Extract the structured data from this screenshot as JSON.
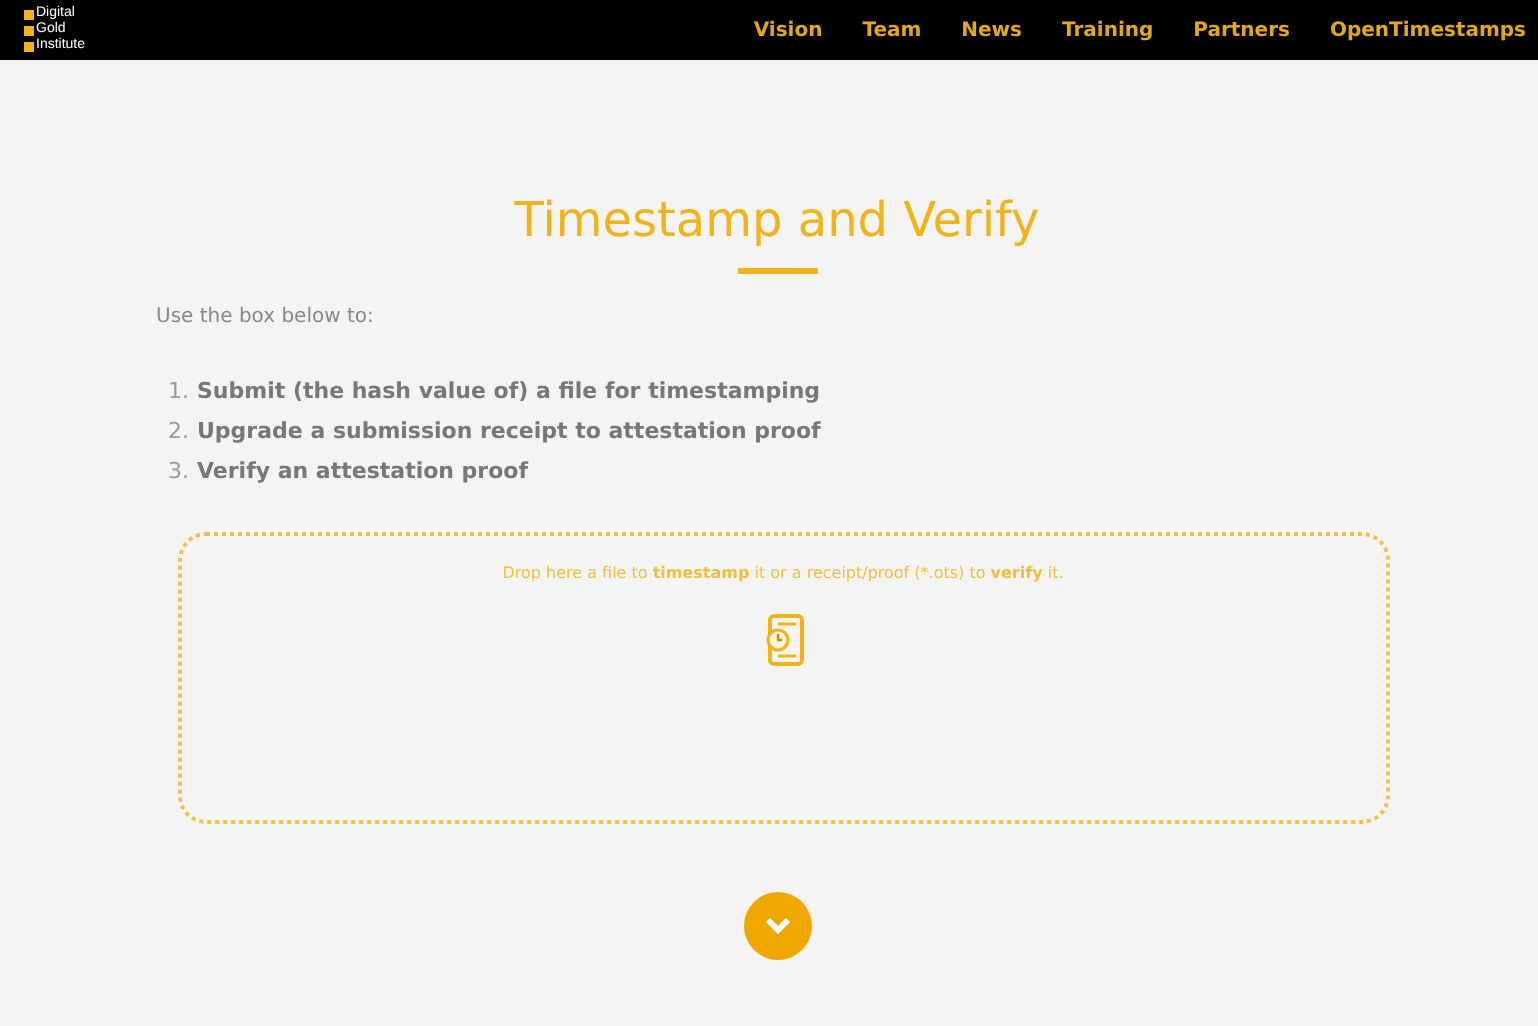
{
  "logo": {
    "lines": [
      "Digital",
      "Gold",
      "Institute"
    ]
  },
  "nav": [
    "Vision",
    "Team",
    "News",
    "Training",
    "Partners",
    "OpenTimestamps"
  ],
  "title": "Timestamp and Verify",
  "intro": "Use the box below to:",
  "steps": [
    {
      "number": "1.",
      "text": "Submit (the hash value of) a file for timestamping"
    },
    {
      "number": "2.",
      "text": "Upgrade a submission receipt to attestation proof"
    },
    {
      "number": "3.",
      "text": "Verify an attestation proof"
    }
  ],
  "dropzone": {
    "text": "Drop here a file to **timestamp** it or a receipt/proof (*.ots) to **verify** it."
  }
}
